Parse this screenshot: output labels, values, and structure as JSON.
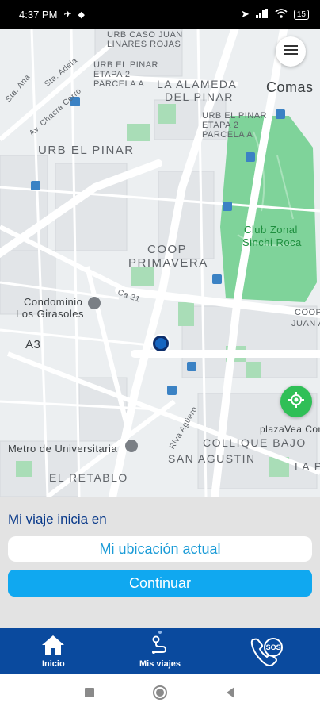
{
  "status_bar": {
    "time": "4:37 PM",
    "battery": "15"
  },
  "map": {
    "labels": {
      "urb_caso_juan": "URB CASO JUAN",
      "linares_rojas": "LINARES ROJAS",
      "urb_el_pinar_top": "URB EL PINAR",
      "etapa_2_top": "ETAPA 2",
      "parcela_a_top": "PARCELA A",
      "la_alameda": "LA ALAMEDA",
      "del_pinar": "DEL PINAR",
      "comas": "Comas",
      "urb_el_pinar_right": "URB EL PINAR",
      "etapa_2_right": "ETAPA 2",
      "parcela_a_right": "PARCELA A",
      "urb_el_pinar": "URB EL PINAR",
      "club_zonal": "Club Zonal",
      "sinchi_roca": "Sinchi Roca",
      "coop": "COOP",
      "primavera": "PRIMAVERA",
      "condominio": "Condominio",
      "los_girasoles": "Los Girasoles",
      "a3": "A3",
      "coop_right": "COOP",
      "juan_a": "JUAN A",
      "plazavea": "plazaVea Coma",
      "metro": "Metro de Universitaria",
      "colique_bajo": "COLLIQUE BAJO",
      "san_agustin": "SAN AGUSTIN",
      "el_retablo": "EL RETABLO",
      "la_p": "LA P",
      "sta_ana": "Sta. Ana",
      "sta_adela": "Sta. Adela",
      "av_chacra_cerro": "Av. Chacra Cerro",
      "ca_21": "Ca 21",
      "riva_aguero": "Riva Agüero"
    }
  },
  "sheet": {
    "title": "Mi viaje inicia en",
    "location_value": "Mi ubicación actual",
    "continue_label": "Continuar"
  },
  "bottom_nav": {
    "items": [
      {
        "label": "Inicio"
      },
      {
        "label": "Mis viajes"
      },
      {
        "label": "SOS"
      }
    ]
  },
  "colors": {
    "nav_bg": "#0a4a9e",
    "accent": "#10a8f0",
    "title": "#0a3a8a",
    "locate": "#2fbf56",
    "park": "#7fd39a"
  }
}
